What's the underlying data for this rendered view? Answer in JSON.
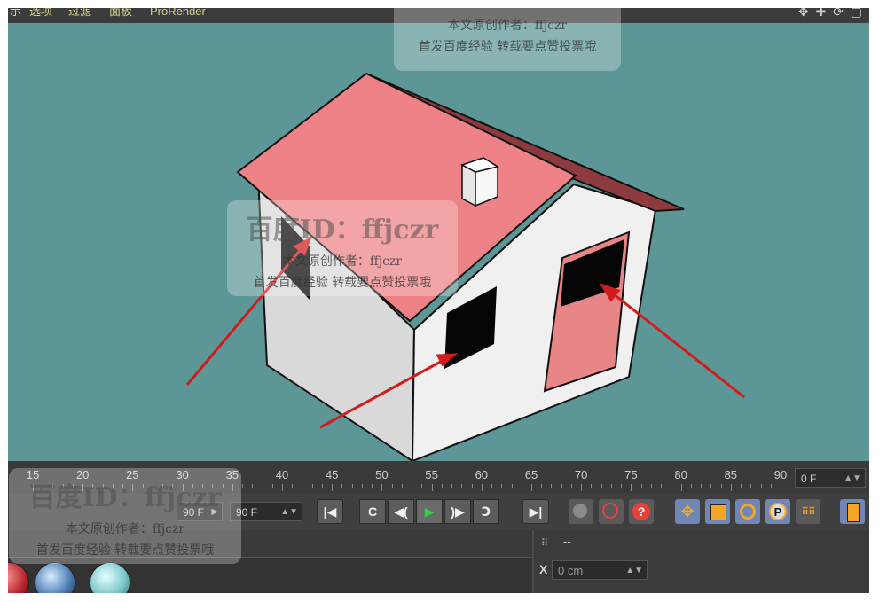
{
  "menu": {
    "items": [
      "选项",
      "过滤",
      "面板",
      "ProRender"
    ]
  },
  "timeline": {
    "ruler_labels": [
      "15",
      "20",
      "25",
      "30",
      "35",
      "40",
      "45",
      "50",
      "55",
      "60",
      "65",
      "70",
      "75",
      "80",
      "85",
      "90"
    ],
    "current_frame": "0 F",
    "min_frame": "90 F",
    "max_frame": "90 F"
  },
  "transport": {
    "buttons": [
      "go-to-start",
      "step-back",
      "previous-key",
      "play-forward",
      "next-key",
      "step-forward",
      "go-to-end"
    ],
    "tools": [
      "record",
      "autokey",
      "keyframe-help",
      "move",
      "scale",
      "rotate",
      "parameter",
      "point-level",
      "filmstrip"
    ]
  },
  "attributes": {
    "header_value": "--",
    "x_label": "X",
    "x_value": "0 cm"
  },
  "watermark": {
    "id_text": "百度ID：ffjczr",
    "author_line": "本文原创作者：ffjczr",
    "notice_line": "首发百度经验 转载要点赞投票哦"
  },
  "colors": {
    "viewport_bg": "#5d9696",
    "roof": "#ef8286",
    "wall": "#ececec",
    "door": "#e88587",
    "arrow": "#d11c1c",
    "play": "#2fce46",
    "record": "#e8413a"
  }
}
